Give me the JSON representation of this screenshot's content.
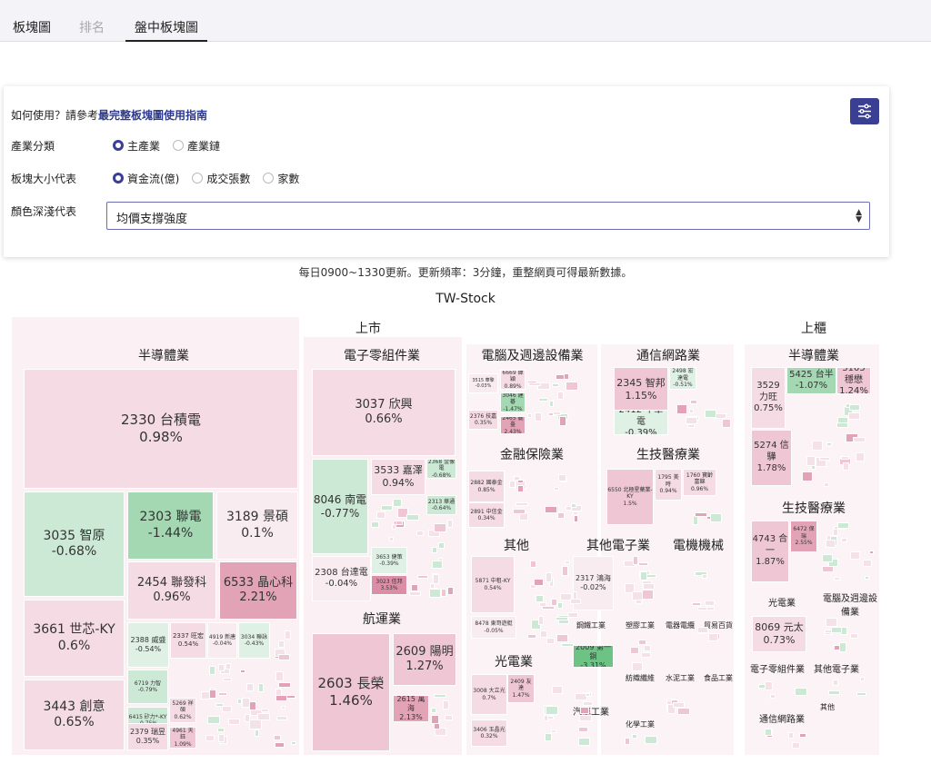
{
  "tabs": [
    {
      "label": "板塊圖",
      "state": "normal"
    },
    {
      "label": "排名",
      "state": "dim"
    },
    {
      "label": "盤中板塊圖",
      "state": "active"
    }
  ],
  "help": {
    "prefix": "如何使用？請參考",
    "link": "最完整板塊圖使用指南"
  },
  "industry": {
    "label": "產業分類",
    "options": [
      "主產業",
      "產業鏈"
    ],
    "selected": "主產業"
  },
  "size": {
    "label": "板塊大小代表",
    "options": [
      "資金流(億)",
      "成交張數",
      "家數"
    ],
    "selected": "資金流(億)"
  },
  "color": {
    "label": "顏色深淺代表",
    "value": "均價支撐強度"
  },
  "settings_icon": "sliders-icon",
  "update_note": "每日0900~1330更新。更新頻率：3分鐘，重整網頁可得最新數據。",
  "chart_data": {
    "type": "treemap",
    "title": "TW-Stock",
    "markets": [
      "上市",
      "上櫃"
    ],
    "sectors": [
      "半導體業",
      "電子零組件業",
      "電腦及週邊設備業",
      "通信網路業",
      "金融保險業",
      "生技醫療業",
      "其他",
      "其他電子業",
      "電機機械",
      "光電業",
      "航運業",
      "鋼鐵工業",
      "塑膠工業",
      "電器電纜",
      "貿易百貨",
      "紡織纖維",
      "水泥工業",
      "食品工業",
      "汽車工業",
      "化學工業",
      "半導體業",
      "生技醫療業",
      "光電業",
      "電腦及週邊設備業",
      "電子零組件業",
      "其他電子業",
      "通信網路業",
      "其他"
    ],
    "stocks": [
      {
        "label": "2330 台積電",
        "change": "0.98%"
      },
      {
        "label": "3035 智原",
        "change": "-0.68%"
      },
      {
        "label": "2303 聯電",
        "change": "-1.44%"
      },
      {
        "label": "3189 景碩",
        "change": "0.1%"
      },
      {
        "label": "2454 聯發科",
        "change": "0.96%"
      },
      {
        "label": "6533 晶心科",
        "change": "2.21%"
      },
      {
        "label": "3661 世芯-KY",
        "change": "0.6%"
      },
      {
        "label": "3443 創意",
        "change": "0.65%"
      },
      {
        "label": "2388 威盛",
        "change": "-0.54%"
      },
      {
        "label": "2337 旺宏",
        "change": "0.54%"
      },
      {
        "label": "4919 新唐",
        "change": "-0.04%"
      },
      {
        "label": "3034 聯詠",
        "change": "-0.43%"
      },
      {
        "label": "6719 力智",
        "change": "-0.79%"
      },
      {
        "label": "6415 矽力*-KY",
        "change": "-0.75%"
      },
      {
        "label": "5269 祥碩",
        "change": "0.62%"
      },
      {
        "label": "2379 瑞昱",
        "change": "0.35%"
      },
      {
        "label": "4961 天鈺",
        "change": "1.09%"
      },
      {
        "label": "3037 欣興",
        "change": "0.66%"
      },
      {
        "label": "8046 南電",
        "change": "-0.77%"
      },
      {
        "label": "3533 嘉澤",
        "change": "0.94%"
      },
      {
        "label": "2368 金像電",
        "change": "-0.68%"
      },
      {
        "label": "2313 華通",
        "change": "-0.64%"
      },
      {
        "label": "3653 健策",
        "change": "-0.39%"
      },
      {
        "label": "2308 台達電",
        "change": "-0.04%"
      },
      {
        "label": "3023 信邦",
        "change": "3.53%"
      },
      {
        "label": "2603 長榮",
        "change": "1.46%"
      },
      {
        "label": "2609 陽明",
        "change": "1.27%"
      },
      {
        "label": "2615 萬海",
        "change": "2.13%"
      },
      {
        "label": "6669 緯穎",
        "change": "0.89%"
      },
      {
        "label": "3515 華擎",
        "change": "-0.03%"
      },
      {
        "label": "3046 建碁",
        "change": "-1.47%"
      },
      {
        "label": "2376 技嘉",
        "change": "0.35%"
      },
      {
        "label": "2465 麗臺",
        "change": "2.43%"
      },
      {
        "label": "2345 智邦",
        "change": "1.15%"
      },
      {
        "label": "2498 宏達電",
        "change": "-0.51%"
      },
      {
        "label": "2412 中華電",
        "change": "-0.39%"
      },
      {
        "label": "2882 國泰金",
        "change": "0.85%"
      },
      {
        "label": "2891 中信金",
        "change": "0.34%"
      },
      {
        "label": "6550 北極星藥業-KY",
        "change": "1.5%"
      },
      {
        "label": "1795 美時",
        "change": "0.94%"
      },
      {
        "label": "1760 寶齡富錦",
        "change": "0.96%"
      },
      {
        "label": "5871 中租-KY",
        "change": "0.54%"
      },
      {
        "label": "8478 東哥遊艇",
        "change": "-0.05%"
      },
      {
        "label": "2317 鴻海",
        "change": "-0.02%"
      },
      {
        "label": "2009 第一銅",
        "change": "-3.31%"
      },
      {
        "label": "3008 大立光",
        "change": "0.7%"
      },
      {
        "label": "2409 友達",
        "change": "1.47%"
      },
      {
        "label": "3406 玉晶光",
        "change": "0.32%"
      },
      {
        "label": "5425 台半",
        "change": "-1.07%"
      },
      {
        "label": "3105 穩懋",
        "change": "1.24%"
      },
      {
        "label": "3529 力旺",
        "change": "0.75%"
      },
      {
        "label": "5274 信驊",
        "change": "1.78%"
      },
      {
        "label": "4743 合一",
        "change": "1.87%"
      },
      {
        "label": "6472 保瑞",
        "change": "2.55%"
      },
      {
        "label": "8069 元太",
        "change": "0.73%"
      }
    ]
  }
}
